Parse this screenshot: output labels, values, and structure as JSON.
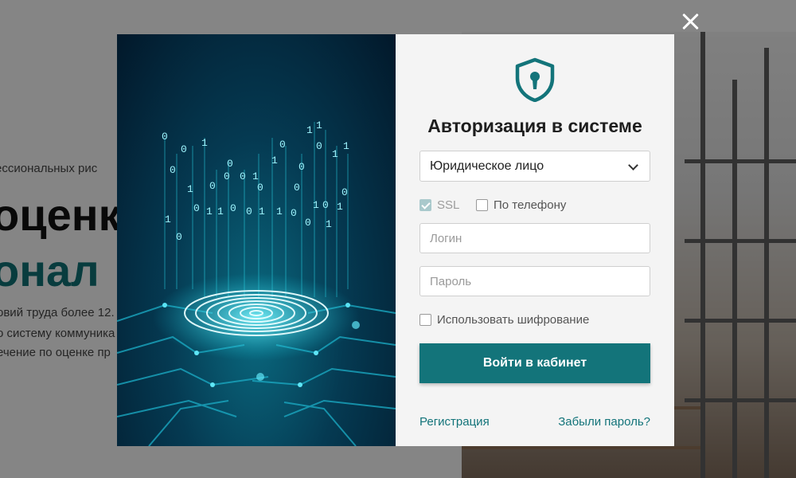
{
  "background": {
    "line1": "ессиональных рис",
    "heading1": "оценк",
    "heading2": "онал",
    "para1": "овий труда более 12.",
    "para2": "о систему коммуника",
    "para3": "ечение по оценке пр"
  },
  "modal": {
    "title": "Авторизация в системе",
    "entity_select": {
      "value": "Юридическое лицо"
    },
    "options": {
      "ssl": {
        "label": "SSL",
        "checked": true
      },
      "phone": {
        "label": "По телефону",
        "checked": false
      }
    },
    "login": {
      "placeholder": "Логин"
    },
    "password": {
      "placeholder": "Пароль"
    },
    "encrypt": {
      "label": "Использовать шифрование",
      "checked": false
    },
    "submit_label": "Войти в кабинет",
    "register_link": "Регистрация",
    "forgot_link": "Забыли пароль?",
    "icon": "shield-keyhole-icon",
    "accent_color": "#13747a"
  },
  "close_icon": "close-icon"
}
